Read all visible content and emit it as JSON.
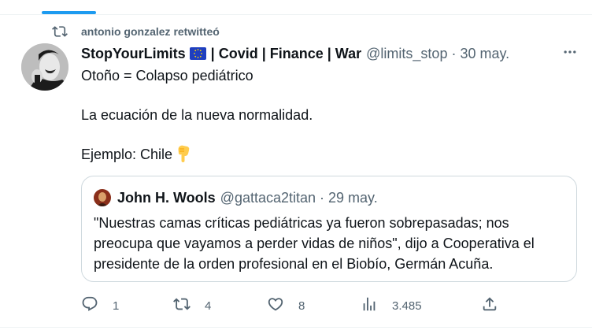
{
  "retweet": {
    "text": "antonio gonzalez retwitteó"
  },
  "tweet": {
    "display_name": "StopYourLimits",
    "name_suffix": "| Covid | Finance | War",
    "handle": "@limits_stop",
    "separator": "·",
    "date": "30 may.",
    "lines": [
      "Otoño = Colapso pediátrico",
      "La ecuación de la nueva normalidad.",
      "Ejemplo: Chile"
    ]
  },
  "quote": {
    "display_name": "John H. Wools",
    "handle": "@gattaca2titan",
    "separator": "·",
    "date": "29 may.",
    "lines": [
      "\"Nuestras camas críticas pediátricas ya fueron sobrepasadas; nos",
      "preocupa que vayamos a perder vidas de niños\", dijo a Cooperativa el",
      "presidente de la orden profesional en el Biobío, Germán Acuña."
    ]
  },
  "actions": {
    "replies": "1",
    "retweets": "4",
    "likes": "8",
    "views": "3.485"
  },
  "colors": {
    "accent": "#1d9bf0",
    "text": "#0f1419",
    "secondary_text": "#536471",
    "border": "#cfd9de"
  },
  "icons": {
    "retweet": "retweet-icon",
    "flag": "eu-flag-icon",
    "more": "more-icon",
    "hand": "backhand-index-pointing-down-icon",
    "reply": "reply-icon",
    "like": "heart-icon",
    "views": "views-icon",
    "share": "share-icon"
  }
}
